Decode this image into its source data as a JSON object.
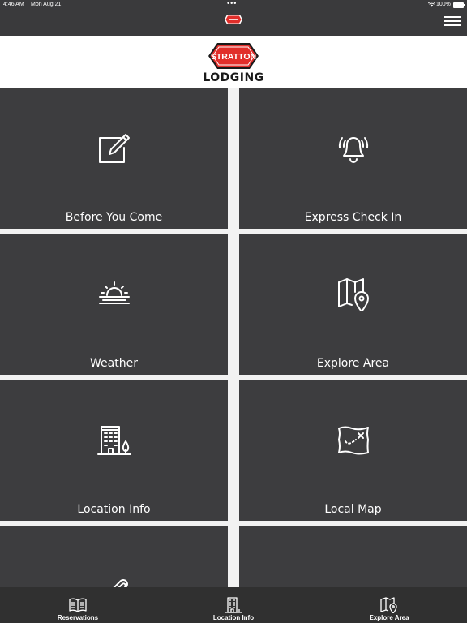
{
  "status_bar": {
    "time": "4:46 AM",
    "date": "Mon Aug 21",
    "battery": "100%"
  },
  "brand": {
    "name": "STRATTON",
    "subtitle": "LODGING",
    "color": "#e12e2a"
  },
  "tiles": [
    {
      "label": "Before You Come",
      "icon": "edit-note-icon"
    },
    {
      "label": "Express Check In",
      "icon": "bell-alert-icon"
    },
    {
      "label": "Weather",
      "icon": "sunrise-icon"
    },
    {
      "label": "Explore Area",
      "icon": "map-pin-icon"
    },
    {
      "label": "Location Info",
      "icon": "building-icon"
    },
    {
      "label": "Local Map",
      "icon": "treasure-map-icon"
    },
    {
      "label": "",
      "icon": "paperclip-icon"
    },
    {
      "label": "",
      "icon": "person-icon"
    }
  ],
  "tab_bar": [
    {
      "label": "Reservations",
      "icon": "book-icon"
    },
    {
      "label": "Location Info",
      "icon": "building-icon"
    },
    {
      "label": "Explore Area",
      "icon": "map-pin-icon"
    }
  ]
}
